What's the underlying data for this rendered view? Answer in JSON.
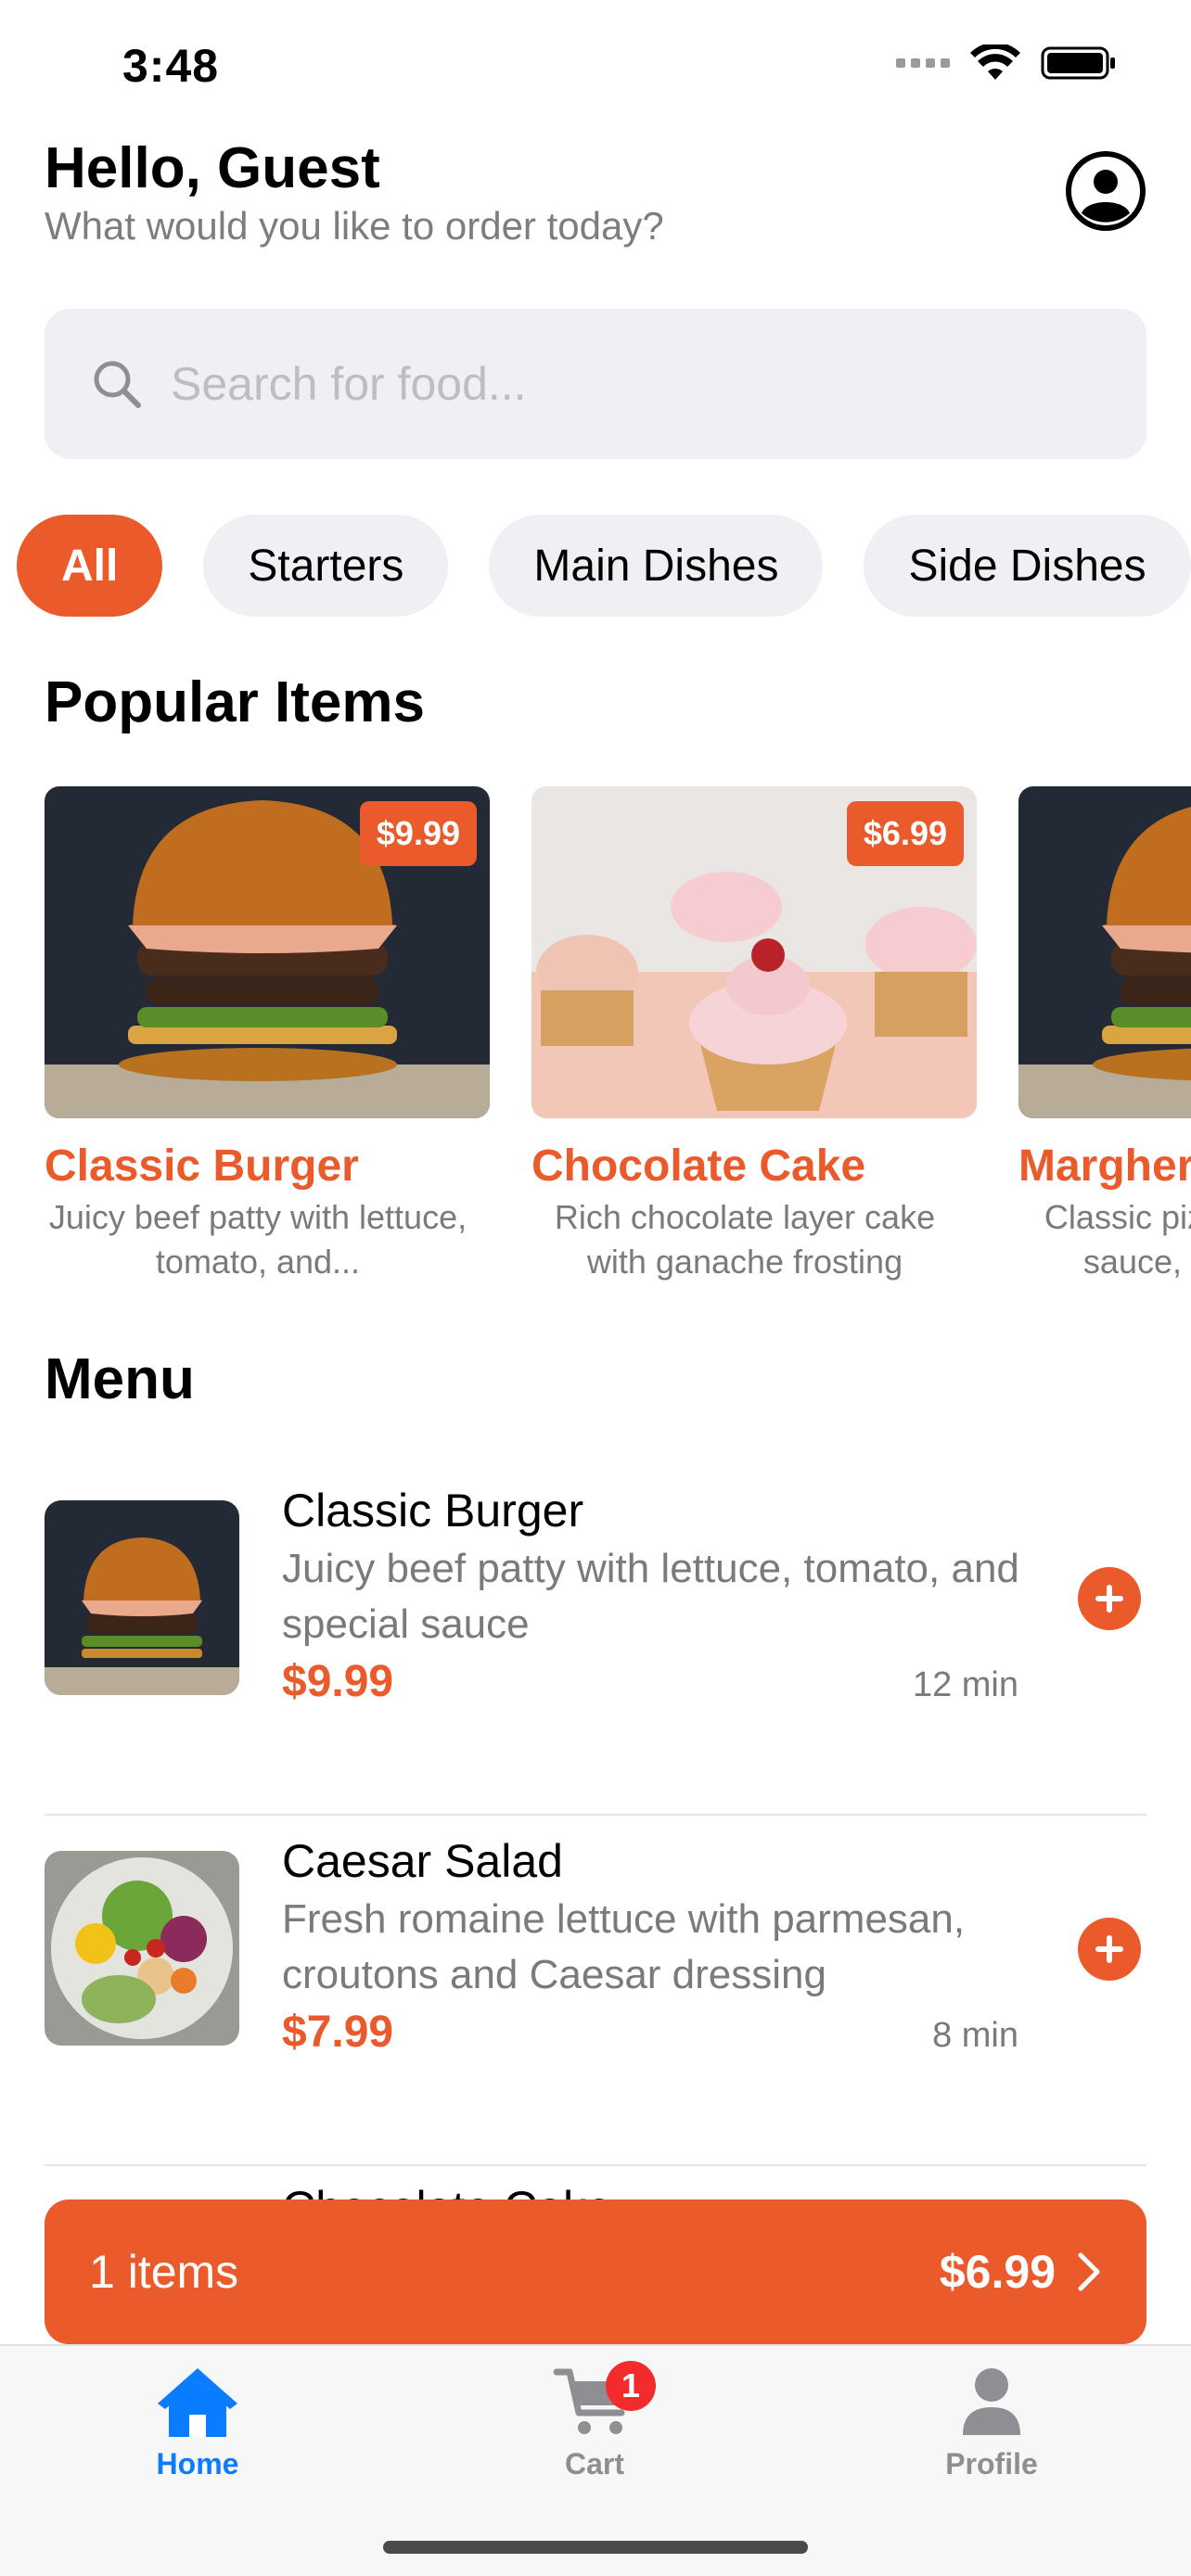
{
  "status_bar": {
    "time": "3:48"
  },
  "header": {
    "greeting": "Hello, Guest",
    "subtitle": "What would you like to order today?"
  },
  "search": {
    "placeholder": "Search for food...",
    "icon": "search-icon"
  },
  "categories": [
    {
      "label": "All",
      "active": true
    },
    {
      "label": "Starters",
      "active": false
    },
    {
      "label": "Main Dishes",
      "active": false
    },
    {
      "label": "Side Dishes",
      "active": false
    }
  ],
  "popular": {
    "title": "Popular Items",
    "items": [
      {
        "name": "Classic Burger",
        "price": "$9.99",
        "description": "Juicy beef patty with lettuce, tomato, and..."
      },
      {
        "name": "Chocolate Cake",
        "price": "$6.99",
        "description": "Rich chocolate layer cake with ganache frosting"
      },
      {
        "name": "Margherita Pizza",
        "price": "",
        "description": "Classic pizza with tomato sauce, mozzarella..."
      }
    ]
  },
  "menu": {
    "title": "Menu",
    "items": [
      {
        "name": "Classic Burger",
        "description": "Juicy beef patty with lettuce, tomato, and special sauce",
        "price": "$9.99",
        "time": "12 min"
      },
      {
        "name": "Caesar Salad",
        "description": "Fresh romaine lettuce with parmesan, croutons and Caesar dressing",
        "price": "$7.99",
        "time": "8 min"
      }
    ],
    "partial_item_name": "Chocolate Cake"
  },
  "cart_bar": {
    "count_label": "1 items",
    "total": "$6.99"
  },
  "tab_bar": {
    "tabs": [
      {
        "label": "Home",
        "icon": "house-icon",
        "active": true
      },
      {
        "label": "Cart",
        "icon": "cart-icon",
        "active": false,
        "badge": "1"
      },
      {
        "label": "Profile",
        "icon": "person-icon",
        "active": false
      }
    ]
  },
  "colors": {
    "accent": "#ea5a2a",
    "tab_active": "#0a7cff",
    "badge": "#f22c2c"
  }
}
